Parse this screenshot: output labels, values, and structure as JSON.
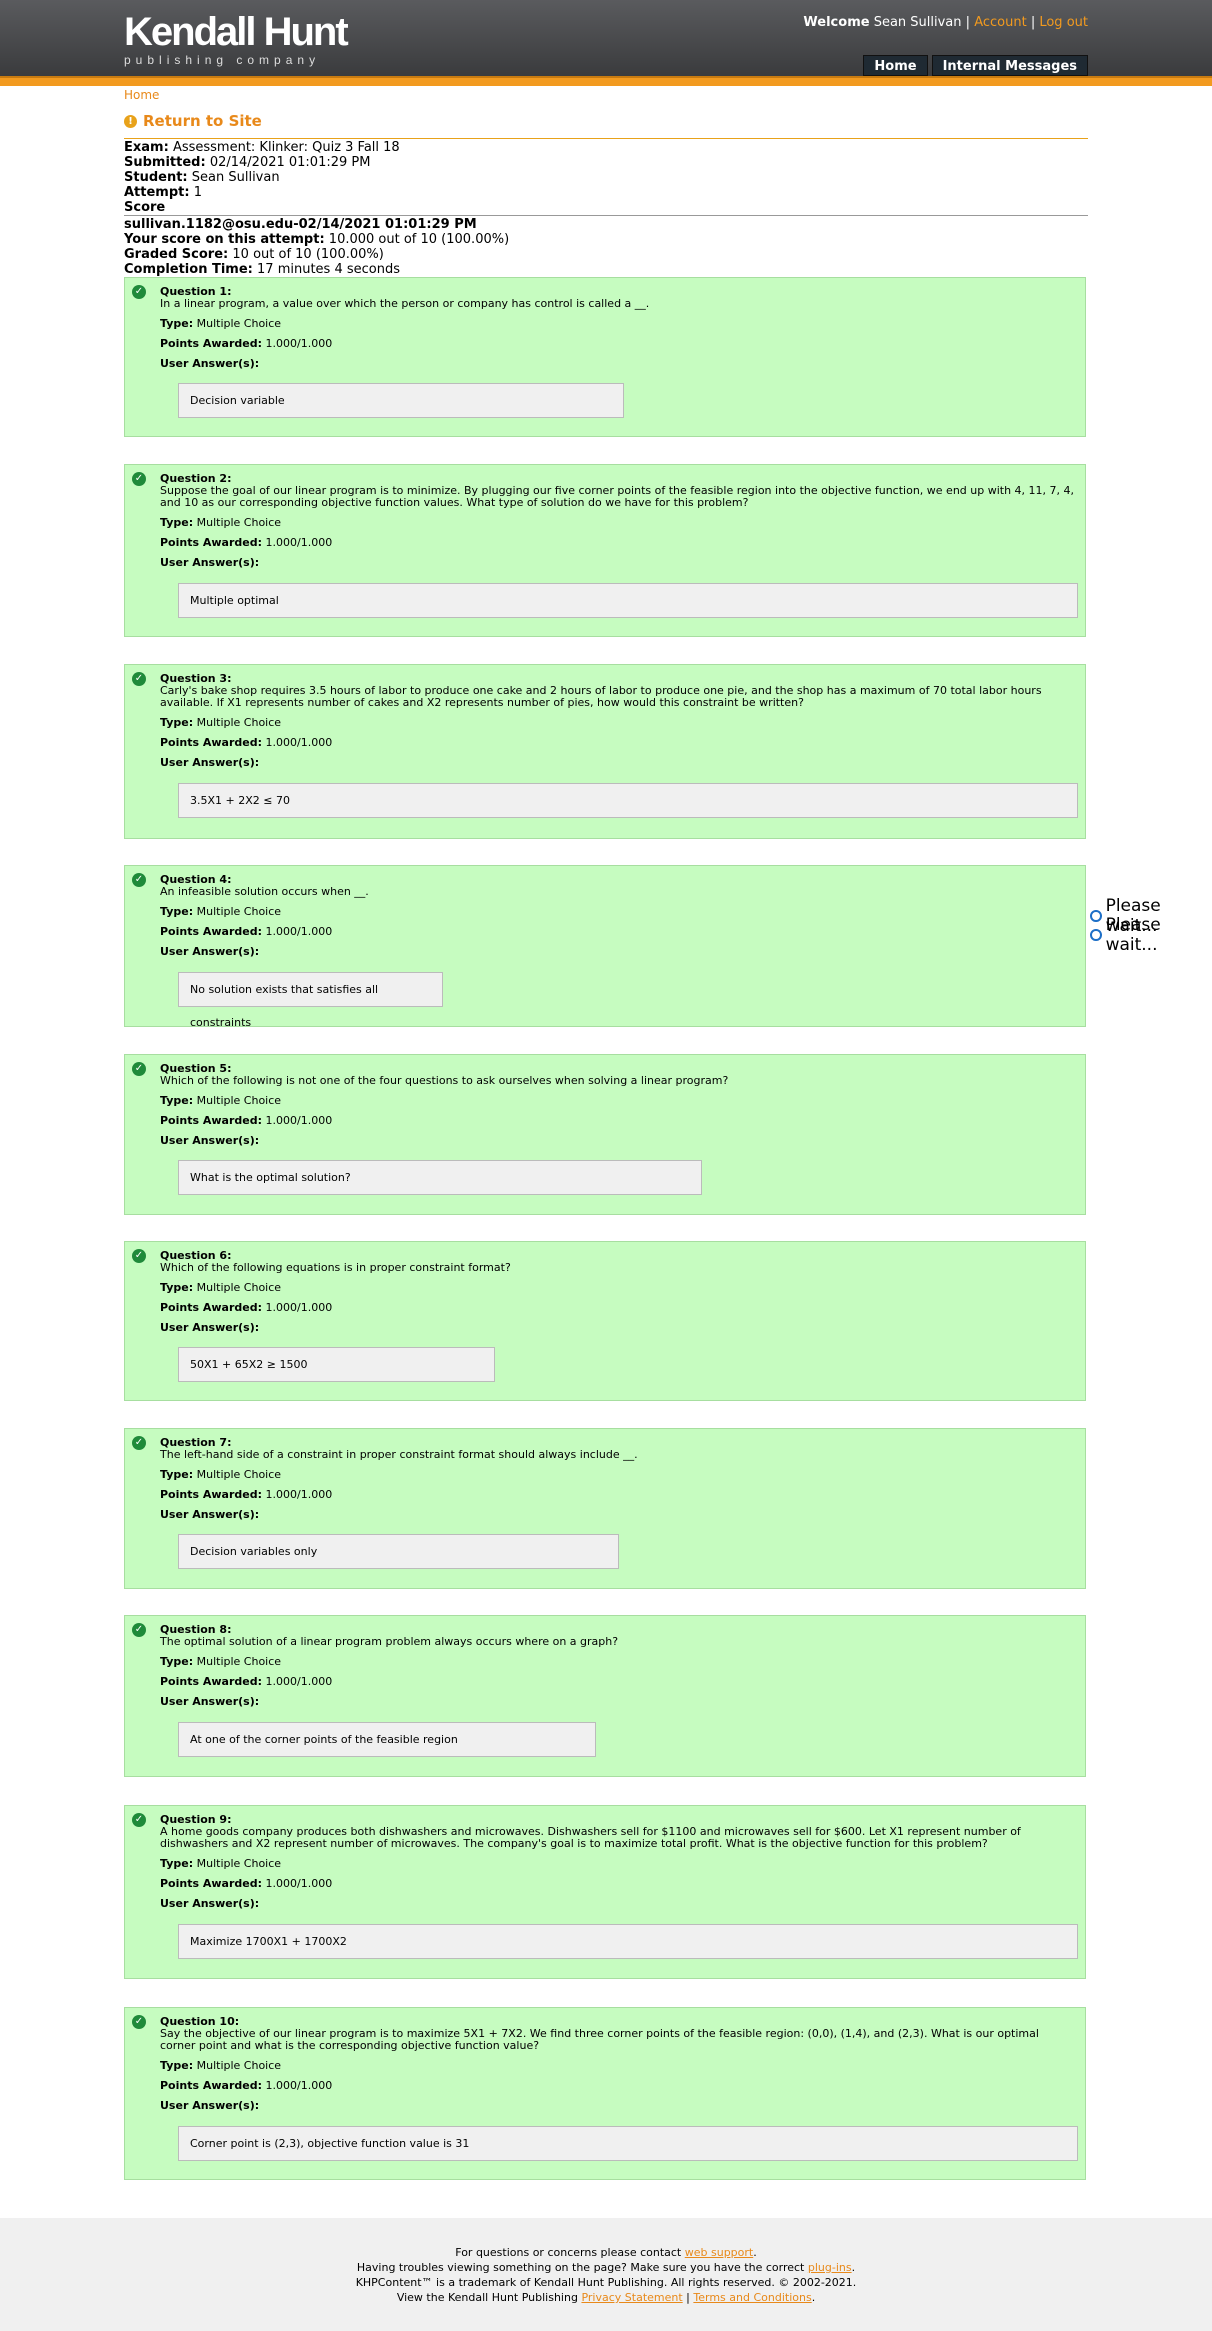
{
  "header": {
    "logo_main": "Kendall Hunt",
    "logo_sub": "publishing company",
    "welcome_label": "Welcome",
    "user_name": "Sean Sullivan",
    "account_link": "Account",
    "logout_link": "Log out",
    "nav": [
      "Home",
      "Internal Messages"
    ]
  },
  "breadcrumb": "Home",
  "return_link": "Return to Site",
  "meta": {
    "exam_label": "Exam:",
    "exam": "Assessment: Klinker: Quiz 3 Fall 18",
    "submitted_label": "Submitted:",
    "submitted": "02/14/2021 01:01:29 PM",
    "student_label": "Student:",
    "student": "Sean Sullivan",
    "attempt_label": "Attempt:",
    "attempt": "1",
    "score_heading": "Score",
    "attempt_id": "sullivan.1182@osu.edu-02/14/2021 01:01:29 PM",
    "your_score_label": "Your score on this attempt:",
    "your_score": "10.000 out of 10 (100.00%)",
    "graded_label": "Graded Score:",
    "graded": "10 out of 10 (100.00%)",
    "completion_label": "Completion Time:",
    "completion": "17 minutes 4 seconds"
  },
  "labels": {
    "type": "Type:",
    "points": "Points Awarded:",
    "user_answers": "User Answer(s):"
  },
  "questions": [
    {
      "title": "Question 1:",
      "text": "In a linear program, a value over which the person or company has control is called a __.",
      "type": "Multiple Choice",
      "points": "1.000/1.000",
      "answer": "Decision variable"
    },
    {
      "title": "Question 2:",
      "text": "Suppose the goal of our linear program is to minimize. By plugging our five corner points of the feasible region into the objective function, we end up with 4, 11, 7, 4, and 10 as our corresponding objective function values. What type of solution do we have for this problem?",
      "type": "Multiple Choice",
      "points": "1.000/1.000",
      "answer": "Multiple optimal"
    },
    {
      "title": "Question 3:",
      "text": "Carly's bake shop requires 3.5 hours of labor to produce one cake and 2 hours of labor to produce one pie, and the shop has a maximum of 70 total labor hours available. If X1 represents number of cakes and X2 represents number of pies, how would this constraint be written?",
      "type": "Multiple Choice",
      "points": "1.000/1.000",
      "answer": "3.5X1 + 2X2 ≤ 70"
    },
    {
      "title": "Question 4:",
      "text": "An infeasible solution occurs when __.",
      "type": "Multiple Choice",
      "points": "1.000/1.000",
      "answer": "No solution exists that satisfies all constraints"
    },
    {
      "title": "Question 5:",
      "text": "Which of the following is not one of the four questions to ask ourselves when solving a linear program?",
      "type": "Multiple Choice",
      "points": "1.000/1.000",
      "answer": "What is the optimal solution?"
    },
    {
      "title": "Question 6:",
      "text": "Which of the following equations is in proper constraint format?",
      "type": "Multiple Choice",
      "points": "1.000/1.000",
      "answer": "50X1 + 65X2 ≥ 1500"
    },
    {
      "title": "Question 7:",
      "text": "The left-hand side of a constraint in proper constraint format should always include __.",
      "type": "Multiple Choice",
      "points": "1.000/1.000",
      "answer": "Decision variables only"
    },
    {
      "title": "Question 8:",
      "text": "The optimal solution of a linear program problem always occurs where on a graph?",
      "type": "Multiple Choice",
      "points": "1.000/1.000",
      "answer": "At one of the corner points of the feasible region"
    },
    {
      "title": "Question 9:",
      "text": "A home goods company produces both dishwashers and microwaves. Dishwashers sell for $1100 and microwaves sell for $600. Let X1 represent number of dishwashers and X2 represent number of microwaves. The company's goal is to maximize total profit. What is the objective function for this problem?",
      "type": "Multiple Choice",
      "points": "1.000/1.000",
      "answer": "Maximize 1700X1 + 1700X2"
    },
    {
      "title": "Question 10:",
      "text": "Say the objective of our linear program is to maximize 5X1 + 7X2. We find three corner points of the feasible region: (0,0), (1,4), and (2,3). What is our optimal corner point and what is the corresponding objective function value?",
      "type": "Multiple Choice",
      "points": "1.000/1.000",
      "answer": "Corner point is (2,3), objective function value is 31"
    }
  ],
  "please_wait": [
    "Please wait...",
    "Please wait..."
  ],
  "footer": {
    "line1_pre": "For questions or concerns please contact ",
    "line1_link": "web support",
    "line1_post": ".",
    "line2_pre": "Having troubles viewing something on the page? Make sure you have the correct ",
    "line2_link": "plug-ins",
    "line2_post": ".",
    "line3": "KHPContent™ is a trademark of Kendall Hunt Publishing. All rights reserved. © 2002-2021.",
    "line4_pre": "View the Kendall Hunt Publishing ",
    "privacy_link": "Privacy Statement",
    "sep": " | ",
    "terms_link": "Terms and Conditions",
    "line4_post": "."
  }
}
